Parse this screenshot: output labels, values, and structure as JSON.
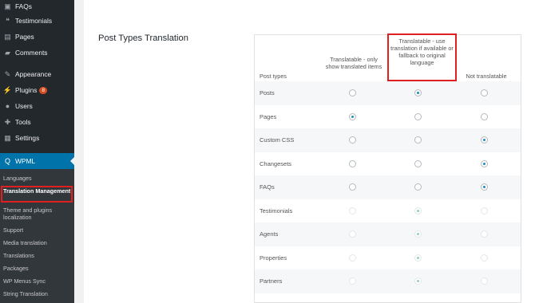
{
  "sidebar": {
    "items": [
      {
        "label": "FAQs",
        "icon": "faq-icon",
        "glyph": "▣"
      },
      {
        "label": "Testimonials",
        "icon": "quote-icon",
        "glyph": "❝"
      },
      {
        "label": "Pages",
        "icon": "pages-icon",
        "glyph": "▤"
      },
      {
        "label": "Comments",
        "icon": "comments-icon",
        "glyph": "▰"
      },
      {
        "label": "Appearance",
        "icon": "appearance-icon",
        "glyph": "✎"
      },
      {
        "label": "Plugins",
        "icon": "plugins-icon",
        "glyph": "⚡",
        "badge": "8"
      },
      {
        "label": "Users",
        "icon": "users-icon",
        "glyph": "●"
      },
      {
        "label": "Tools",
        "icon": "tools-icon",
        "glyph": "✚"
      },
      {
        "label": "Settings",
        "icon": "settings-icon",
        "glyph": "▦"
      }
    ],
    "active": {
      "label": "WPML",
      "icon": "wpml-icon",
      "glyph": "Q"
    },
    "submenu": [
      {
        "label": "Languages"
      },
      {
        "label": "Translation Management",
        "current": true
      },
      {
        "label": "Theme and plugins localization"
      },
      {
        "label": "Support"
      },
      {
        "label": "Media translation"
      },
      {
        "label": "Translations"
      },
      {
        "label": "Packages"
      },
      {
        "label": "WP Menus Sync"
      },
      {
        "label": "String Translation"
      }
    ]
  },
  "main": {
    "section_title": "Post Types Translation",
    "table": {
      "headers": {
        "post_types": "Post types",
        "only_translated": "Translatable - only show translated items",
        "fallback": "Translatable - use translation if available or fallback to original language",
        "not_translatable": "Not translatable"
      },
      "rows": [
        {
          "label": "Posts",
          "selected": 1,
          "disabled": false
        },
        {
          "label": "Pages",
          "selected": 0,
          "disabled": false
        },
        {
          "label": "Custom CSS",
          "selected": 2,
          "disabled": false
        },
        {
          "label": "Changesets",
          "selected": 2,
          "disabled": false
        },
        {
          "label": "FAQs",
          "selected": 2,
          "disabled": false
        },
        {
          "label": "Testimonials",
          "selected": 1,
          "disabled": true
        },
        {
          "label": "Agents",
          "selected": 1,
          "disabled": true
        },
        {
          "label": "Properties",
          "selected": 1,
          "disabled": true
        },
        {
          "label": "Partners",
          "selected": 1,
          "disabled": true
        }
      ]
    }
  },
  "colors": {
    "sidebar_bg": "#23282d",
    "active_bg": "#0073aa",
    "highlight": "#e02020",
    "radio_checked": "#1e8cbe"
  }
}
